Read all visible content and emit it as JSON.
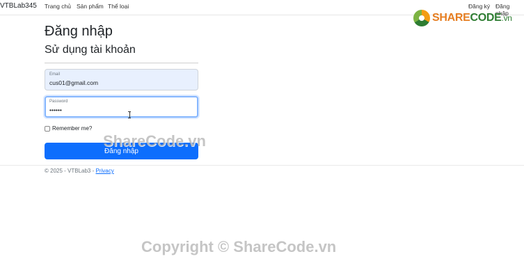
{
  "nav": {
    "brand": "VTBLab345",
    "links": [
      "Trang chủ",
      "Sản phẩm",
      "Thể loại"
    ],
    "register": "Đăng ký",
    "login": "Đăng nhập"
  },
  "logo": {
    "part1": "SHARE",
    "part2": "CODE",
    "part3": ".vn"
  },
  "page": {
    "title": "Đăng nhập",
    "subtitle": "Sử dụng tài khoản"
  },
  "form": {
    "email_label": "Email",
    "email_value": "cus01@gmail.com",
    "password_label": "Password",
    "password_value": "••••••",
    "remember_label": "Remember me?",
    "submit_label": "Đăng nhập"
  },
  "footer": {
    "copyright": "© 2025 - VTBLab3 - ",
    "privacy": "Privacy"
  },
  "watermarks": {
    "center": "ShareCode.vn",
    "bottom": "Copyright © ShareCode.vn"
  },
  "colors": {
    "primary": "#0d6efd",
    "autofill_bg": "#e8f0fe",
    "focus_border": "#86b7fe"
  }
}
